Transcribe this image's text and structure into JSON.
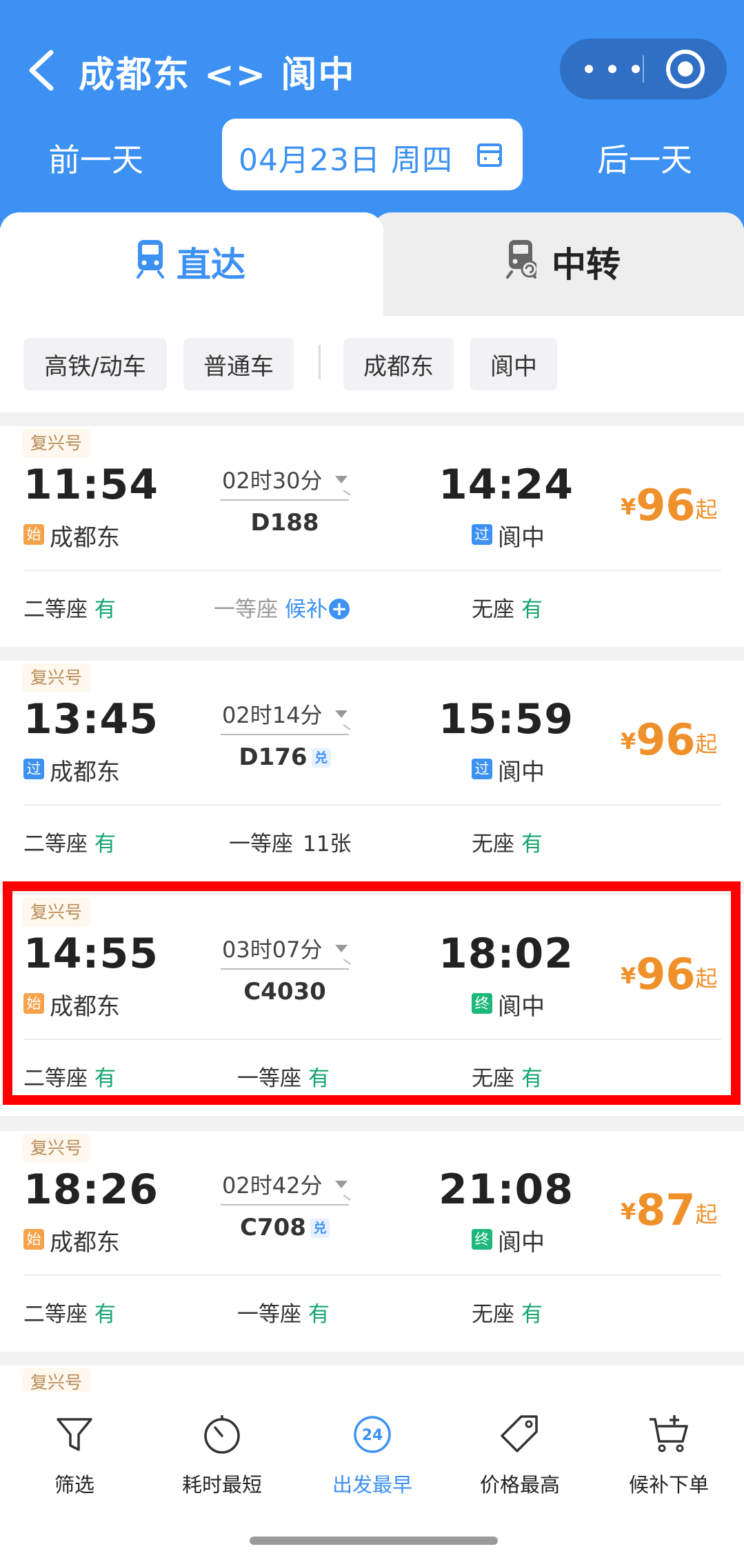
{
  "header": {
    "route_title": "成都东 <> 阆中",
    "prev_day": "前一天",
    "next_day": "后一天",
    "date": "04月23日 周四"
  },
  "tabs": {
    "direct": "直达",
    "transfer": "中转"
  },
  "filters": [
    "高铁/动车",
    "普通车",
    "成都东",
    "阆中"
  ],
  "trains": [
    {
      "brand": "复兴号",
      "dep_time": "11:54",
      "arr_time": "14:24",
      "dep_tag": "始",
      "dep_station": "成都东",
      "arr_tag": "过",
      "arr_station": "阆中",
      "duration": "02时30分",
      "train_no": "D188",
      "dui": "",
      "price_symbol": "¥",
      "price": "96",
      "price_suffix": "起",
      "seats": [
        {
          "class": "二等座",
          "status": "有"
        },
        {
          "class": "一等座",
          "status": "候补"
        },
        {
          "class": "无座",
          "status": "有"
        }
      ]
    },
    {
      "brand": "复兴号",
      "dep_time": "13:45",
      "arr_time": "15:59",
      "dep_tag": "过",
      "dep_station": "成都东",
      "arr_tag": "过",
      "arr_station": "阆中",
      "duration": "02时14分",
      "train_no": "D176",
      "dui": "兑",
      "price_symbol": "¥",
      "price": "96",
      "price_suffix": "起",
      "seats": [
        {
          "class": "二等座",
          "status": "有"
        },
        {
          "class": "一等座",
          "status": "11张"
        },
        {
          "class": "无座",
          "status": "有"
        }
      ]
    },
    {
      "brand": "复兴号",
      "dep_time": "14:55",
      "arr_time": "18:02",
      "dep_tag": "始",
      "dep_station": "成都东",
      "arr_tag": "终",
      "arr_station": "阆中",
      "duration": "03时07分",
      "train_no": "C4030",
      "dui": "",
      "price_symbol": "¥",
      "price": "96",
      "price_suffix": "起",
      "seats": [
        {
          "class": "二等座",
          "status": "有"
        },
        {
          "class": "一等座",
          "status": "有"
        },
        {
          "class": "无座",
          "status": "有"
        }
      ]
    },
    {
      "brand": "复兴号",
      "dep_time": "18:26",
      "arr_time": "21:08",
      "dep_tag": "始",
      "dep_station": "成都东",
      "arr_tag": "终",
      "arr_station": "阆中",
      "duration": "02时42分",
      "train_no": "C708",
      "dui": "兑",
      "price_symbol": "¥",
      "price": "87",
      "price_suffix": "起",
      "seats": [
        {
          "class": "二等座",
          "status": "有"
        },
        {
          "class": "一等座",
          "status": "有"
        },
        {
          "class": "无座",
          "status": "有"
        }
      ]
    },
    {
      "brand": "复兴号"
    }
  ],
  "bottom_bar": [
    {
      "label": "筛选",
      "icon": "filter-icon"
    },
    {
      "label": "耗时最短",
      "icon": "timer-icon"
    },
    {
      "label": "出发最早",
      "icon": "clock-24-icon",
      "active": true
    },
    {
      "label": "价格最高",
      "icon": "price-tag-icon"
    },
    {
      "label": "候补下单",
      "icon": "cart-add-icon"
    }
  ],
  "colors": {
    "primary": "#3c91f3",
    "price": "#f0902a",
    "available": "#16a56e",
    "highlight": "#ff0000",
    "tag_start": "#f5a24a",
    "tag_pass": "#3c91f3",
    "tag_end": "#1db77a"
  }
}
